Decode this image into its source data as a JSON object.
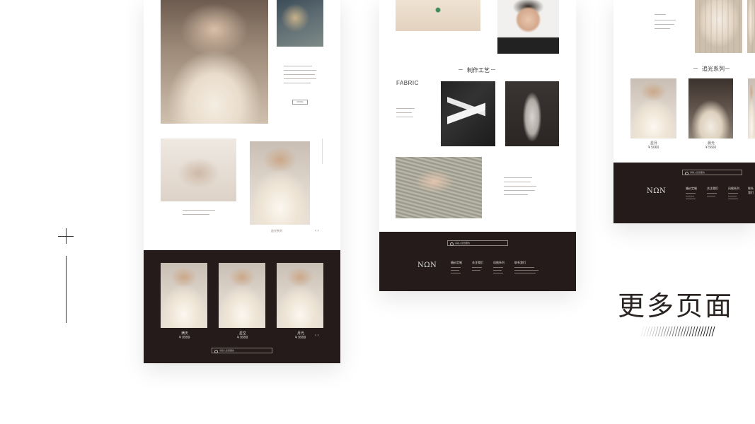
{
  "heading": "更多页面",
  "card1": {
    "more_button": "MORE",
    "arrows": "‹ ›",
    "caption": "追光系列",
    "products": [
      {
        "name": "满天",
        "price": "¥ 9999"
      },
      {
        "name": "星空",
        "price": "¥ 9999"
      },
      {
        "name": "月光",
        "price": "¥ 9999"
      }
    ],
    "search_placeholder": "请输入您想要的"
  },
  "card2": {
    "section_title": "制作工艺",
    "fabric_label": "FABRIC",
    "search_placeholder": "请输入您想要的",
    "logo": "NΩN",
    "footer": [
      {
        "heading": "婚纱定制"
      },
      {
        "heading": "关注我们"
      },
      {
        "heading": "风格系列"
      },
      {
        "heading": "联系我们"
      }
    ]
  },
  "card3": {
    "section_title": "追光系列",
    "products": [
      {
        "name": "星月",
        "price": "¥ 5660"
      },
      {
        "name": "晨光",
        "price": "¥ 5660"
      }
    ],
    "search_placeholder": "请输入您想要的",
    "logo": "NΩN",
    "footer": [
      {
        "heading": "婚纱定制"
      },
      {
        "heading": "关注我们"
      },
      {
        "heading": "风格系列"
      },
      {
        "heading": "联系我们"
      }
    ]
  }
}
